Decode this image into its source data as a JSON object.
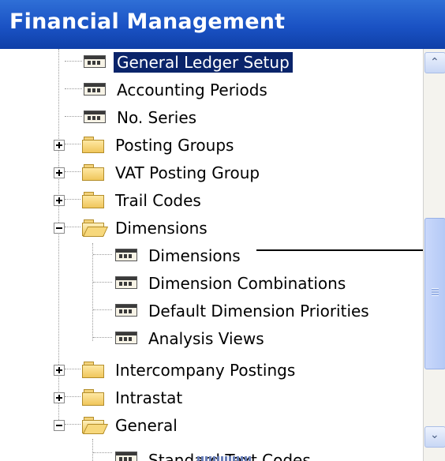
{
  "header": {
    "title": "Financial Management"
  },
  "tree": {
    "items": [
      {
        "label": "General Ledger Setup",
        "type": "doc",
        "selected": true
      },
      {
        "label": "Accounting Periods",
        "type": "doc"
      },
      {
        "label": "No. Series",
        "type": "doc"
      },
      {
        "label": "Posting Groups",
        "type": "folder",
        "state": "collapsed"
      },
      {
        "label": "VAT Posting Group",
        "type": "folder",
        "state": "collapsed"
      },
      {
        "label": "Trail Codes",
        "type": "folder",
        "state": "collapsed"
      },
      {
        "label": "Dimensions",
        "type": "folder",
        "state": "expanded"
      },
      {
        "label": "Dimensions",
        "type": "doc"
      },
      {
        "label": "Dimension Combinations",
        "type": "doc"
      },
      {
        "label": "Default Dimension Priorities",
        "type": "doc"
      },
      {
        "label": "Analysis Views",
        "type": "doc"
      },
      {
        "label": "Intercompany Postings",
        "type": "folder",
        "state": "collapsed"
      },
      {
        "label": "Intrastat",
        "type": "folder",
        "state": "collapsed"
      },
      {
        "label": "General",
        "type": "folder",
        "state": "expanded"
      },
      {
        "label": "Standard Text Codes",
        "type": "doc"
      }
    ]
  },
  "icons": {
    "doc": "form-icon",
    "folder": "folder-icon",
    "folder_open": "folder-open-icon",
    "expand": "plus-expander-icon",
    "collapse": "minus-expander-icon"
  },
  "colors": {
    "header": "#1a52c4",
    "selection": "#0a246a",
    "scroll_thumb": "#c1d3fb"
  }
}
